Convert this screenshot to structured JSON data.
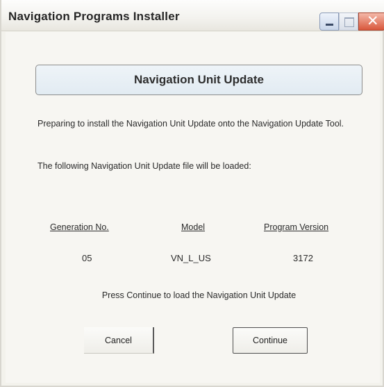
{
  "window": {
    "title": "Navigation Programs Installer",
    "controls": {
      "minimize": "minimize-icon",
      "maximize": "maximize-icon",
      "close": "close-icon",
      "close_glyph": "✕"
    }
  },
  "header": {
    "title": "Navigation Unit Update"
  },
  "body": {
    "paragraph_1": "Preparing to install the Navigation Unit Update onto the Navigation Update Tool.",
    "paragraph_2": "The following Navigation Unit Update file will be loaded:"
  },
  "update_info": {
    "columns": [
      "Generation No.",
      "Model",
      "Program Version"
    ],
    "values": [
      "05",
      "VN_L_US",
      "3172"
    ]
  },
  "prompt": "Press Continue to load the Navigation Unit Update",
  "buttons": {
    "cancel": "Cancel",
    "continue": "Continue"
  },
  "colors": {
    "close_button": "#d9573c",
    "header_box": "#e2ebf2",
    "window_bg": "#f3f2ec"
  }
}
